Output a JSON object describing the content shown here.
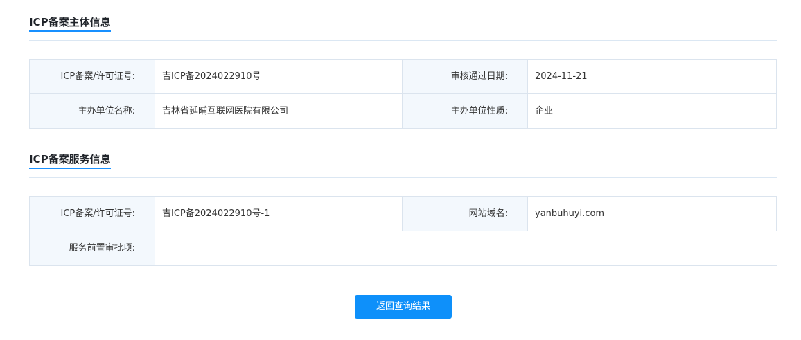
{
  "subject_section": {
    "title": "ICP备案主体信息",
    "rows": [
      [
        {
          "label": "ICP备案/许可证号:",
          "value": "吉ICP备2024022910号"
        },
        {
          "label": "审核通过日期:",
          "value": "2024-11-21"
        }
      ],
      [
        {
          "label": "主办单位名称:",
          "value": "吉林省延晡互联网医院有限公司"
        },
        {
          "label": "主办单位性质:",
          "value": "企业"
        }
      ]
    ]
  },
  "service_section": {
    "title": "ICP备案服务信息",
    "rows": [
      [
        {
          "label": "ICP备案/许可证号:",
          "value": "吉ICP备2024022910号-1"
        },
        {
          "label": "网站域名:",
          "value": "yanbuhuyi.com"
        }
      ],
      [
        {
          "label": "服务前置审批项:",
          "value": ""
        }
      ]
    ]
  },
  "back_button": {
    "label": "返回查询结果"
  }
}
